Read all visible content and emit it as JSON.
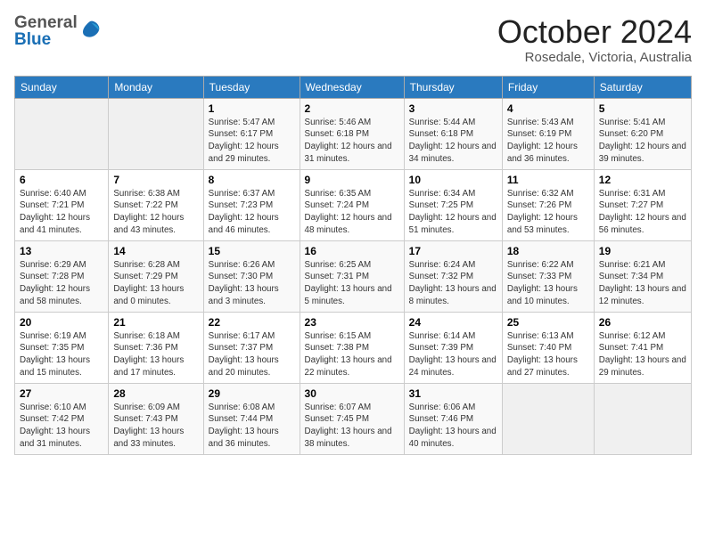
{
  "header": {
    "logo_general": "General",
    "logo_blue": "Blue",
    "month_title": "October 2024",
    "location": "Rosedale, Victoria, Australia"
  },
  "weekdays": [
    "Sunday",
    "Monday",
    "Tuesday",
    "Wednesday",
    "Thursday",
    "Friday",
    "Saturday"
  ],
  "weeks": [
    [
      {
        "day": "",
        "sunrise": "",
        "sunset": "",
        "daylight": ""
      },
      {
        "day": "",
        "sunrise": "",
        "sunset": "",
        "daylight": ""
      },
      {
        "day": "1",
        "sunrise": "Sunrise: 5:47 AM",
        "sunset": "Sunset: 6:17 PM",
        "daylight": "Daylight: 12 hours and 29 minutes."
      },
      {
        "day": "2",
        "sunrise": "Sunrise: 5:46 AM",
        "sunset": "Sunset: 6:18 PM",
        "daylight": "Daylight: 12 hours and 31 minutes."
      },
      {
        "day": "3",
        "sunrise": "Sunrise: 5:44 AM",
        "sunset": "Sunset: 6:18 PM",
        "daylight": "Daylight: 12 hours and 34 minutes."
      },
      {
        "day": "4",
        "sunrise": "Sunrise: 5:43 AM",
        "sunset": "Sunset: 6:19 PM",
        "daylight": "Daylight: 12 hours and 36 minutes."
      },
      {
        "day": "5",
        "sunrise": "Sunrise: 5:41 AM",
        "sunset": "Sunset: 6:20 PM",
        "daylight": "Daylight: 12 hours and 39 minutes."
      }
    ],
    [
      {
        "day": "6",
        "sunrise": "Sunrise: 6:40 AM",
        "sunset": "Sunset: 7:21 PM",
        "daylight": "Daylight: 12 hours and 41 minutes."
      },
      {
        "day": "7",
        "sunrise": "Sunrise: 6:38 AM",
        "sunset": "Sunset: 7:22 PM",
        "daylight": "Daylight: 12 hours and 43 minutes."
      },
      {
        "day": "8",
        "sunrise": "Sunrise: 6:37 AM",
        "sunset": "Sunset: 7:23 PM",
        "daylight": "Daylight: 12 hours and 46 minutes."
      },
      {
        "day": "9",
        "sunrise": "Sunrise: 6:35 AM",
        "sunset": "Sunset: 7:24 PM",
        "daylight": "Daylight: 12 hours and 48 minutes."
      },
      {
        "day": "10",
        "sunrise": "Sunrise: 6:34 AM",
        "sunset": "Sunset: 7:25 PM",
        "daylight": "Daylight: 12 hours and 51 minutes."
      },
      {
        "day": "11",
        "sunrise": "Sunrise: 6:32 AM",
        "sunset": "Sunset: 7:26 PM",
        "daylight": "Daylight: 12 hours and 53 minutes."
      },
      {
        "day": "12",
        "sunrise": "Sunrise: 6:31 AM",
        "sunset": "Sunset: 7:27 PM",
        "daylight": "Daylight: 12 hours and 56 minutes."
      }
    ],
    [
      {
        "day": "13",
        "sunrise": "Sunrise: 6:29 AM",
        "sunset": "Sunset: 7:28 PM",
        "daylight": "Daylight: 12 hours and 58 minutes."
      },
      {
        "day": "14",
        "sunrise": "Sunrise: 6:28 AM",
        "sunset": "Sunset: 7:29 PM",
        "daylight": "Daylight: 13 hours and 0 minutes."
      },
      {
        "day": "15",
        "sunrise": "Sunrise: 6:26 AM",
        "sunset": "Sunset: 7:30 PM",
        "daylight": "Daylight: 13 hours and 3 minutes."
      },
      {
        "day": "16",
        "sunrise": "Sunrise: 6:25 AM",
        "sunset": "Sunset: 7:31 PM",
        "daylight": "Daylight: 13 hours and 5 minutes."
      },
      {
        "day": "17",
        "sunrise": "Sunrise: 6:24 AM",
        "sunset": "Sunset: 7:32 PM",
        "daylight": "Daylight: 13 hours and 8 minutes."
      },
      {
        "day": "18",
        "sunrise": "Sunrise: 6:22 AM",
        "sunset": "Sunset: 7:33 PM",
        "daylight": "Daylight: 13 hours and 10 minutes."
      },
      {
        "day": "19",
        "sunrise": "Sunrise: 6:21 AM",
        "sunset": "Sunset: 7:34 PM",
        "daylight": "Daylight: 13 hours and 12 minutes."
      }
    ],
    [
      {
        "day": "20",
        "sunrise": "Sunrise: 6:19 AM",
        "sunset": "Sunset: 7:35 PM",
        "daylight": "Daylight: 13 hours and 15 minutes."
      },
      {
        "day": "21",
        "sunrise": "Sunrise: 6:18 AM",
        "sunset": "Sunset: 7:36 PM",
        "daylight": "Daylight: 13 hours and 17 minutes."
      },
      {
        "day": "22",
        "sunrise": "Sunrise: 6:17 AM",
        "sunset": "Sunset: 7:37 PM",
        "daylight": "Daylight: 13 hours and 20 minutes."
      },
      {
        "day": "23",
        "sunrise": "Sunrise: 6:15 AM",
        "sunset": "Sunset: 7:38 PM",
        "daylight": "Daylight: 13 hours and 22 minutes."
      },
      {
        "day": "24",
        "sunrise": "Sunrise: 6:14 AM",
        "sunset": "Sunset: 7:39 PM",
        "daylight": "Daylight: 13 hours and 24 minutes."
      },
      {
        "day": "25",
        "sunrise": "Sunrise: 6:13 AM",
        "sunset": "Sunset: 7:40 PM",
        "daylight": "Daylight: 13 hours and 27 minutes."
      },
      {
        "day": "26",
        "sunrise": "Sunrise: 6:12 AM",
        "sunset": "Sunset: 7:41 PM",
        "daylight": "Daylight: 13 hours and 29 minutes."
      }
    ],
    [
      {
        "day": "27",
        "sunrise": "Sunrise: 6:10 AM",
        "sunset": "Sunset: 7:42 PM",
        "daylight": "Daylight: 13 hours and 31 minutes."
      },
      {
        "day": "28",
        "sunrise": "Sunrise: 6:09 AM",
        "sunset": "Sunset: 7:43 PM",
        "daylight": "Daylight: 13 hours and 33 minutes."
      },
      {
        "day": "29",
        "sunrise": "Sunrise: 6:08 AM",
        "sunset": "Sunset: 7:44 PM",
        "daylight": "Daylight: 13 hours and 36 minutes."
      },
      {
        "day": "30",
        "sunrise": "Sunrise: 6:07 AM",
        "sunset": "Sunset: 7:45 PM",
        "daylight": "Daylight: 13 hours and 38 minutes."
      },
      {
        "day": "31",
        "sunrise": "Sunrise: 6:06 AM",
        "sunset": "Sunset: 7:46 PM",
        "daylight": "Daylight: 13 hours and 40 minutes."
      },
      {
        "day": "",
        "sunrise": "",
        "sunset": "",
        "daylight": ""
      },
      {
        "day": "",
        "sunrise": "",
        "sunset": "",
        "daylight": ""
      }
    ]
  ]
}
